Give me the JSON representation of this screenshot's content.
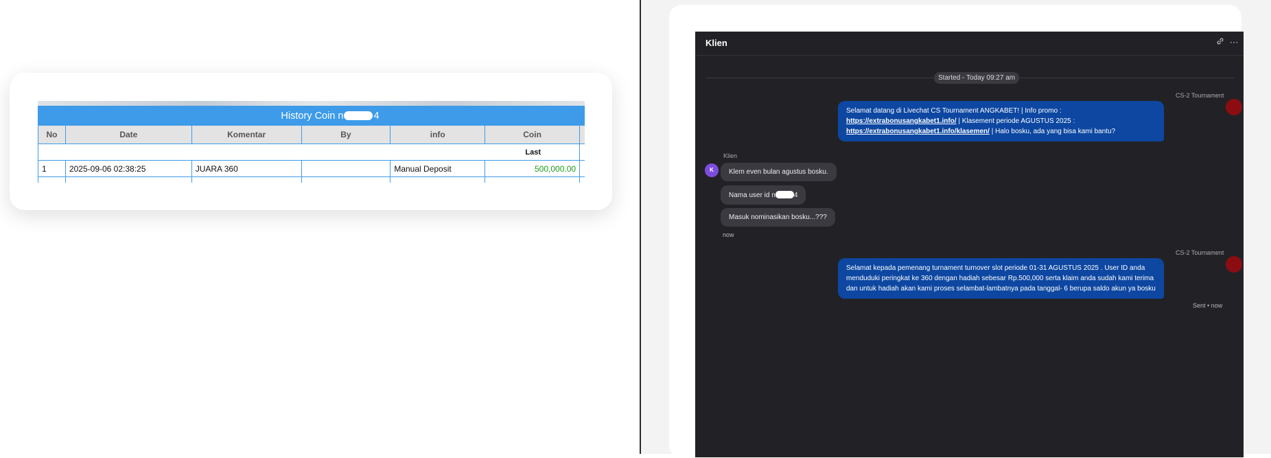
{
  "history": {
    "title_prefix": "History Coin n",
    "title_suffix": "4",
    "columns": [
      "No",
      "Date",
      "Komentar",
      "By",
      "info",
      "Coin"
    ],
    "last_label": "Last",
    "rows": [
      {
        "no": "1",
        "date": "2025-09-06 02:38:25",
        "komentar": "JUARA 360",
        "by": "",
        "info": "Manual Deposit",
        "coin": "500,000.00"
      }
    ]
  },
  "chat": {
    "title": "Klien",
    "started": "Started - Today 09:27 am",
    "agent_name": "CS-2 Tournament",
    "client_name": "Klien",
    "client_initial": "K",
    "msg1": {
      "part1": "Selamat datang di Livechat CS Tournament ANGKABET! | Info promo : ",
      "link1": "https://extrabonusangkabet1.info/",
      "part2": " | Klasement periode AGUSTUS 2025 : ",
      "link2": "https://extrabonusangkabet1.info/klasemen/",
      "part3": " | Halo bosku, ada yang bisa kami bantu?"
    },
    "client_msgs": {
      "m1": "Klem even bulan agustus bosku.",
      "m2_prefix": "Nama user id n",
      "m2_suffix": "4",
      "m3": "Masuk nominasikan bosku...???"
    },
    "client_time": "now",
    "msg2": "Selamat kepada pemenang turnament turnover slot periode 01-31 AGUSTUS 2025 . User ID anda menduduki peringkat ke 360 dengan hadiah sebesar Rp.500,000 serta klaim anda sudah kami terima dan untuk hadiah akan kami proses selambat-lambatnya pada tanggal- 6 berupa saldo akun ya bosku",
    "sent_status": "Sent • now",
    "icons": {
      "link": "link-icon",
      "more": "more-icon"
    }
  }
}
